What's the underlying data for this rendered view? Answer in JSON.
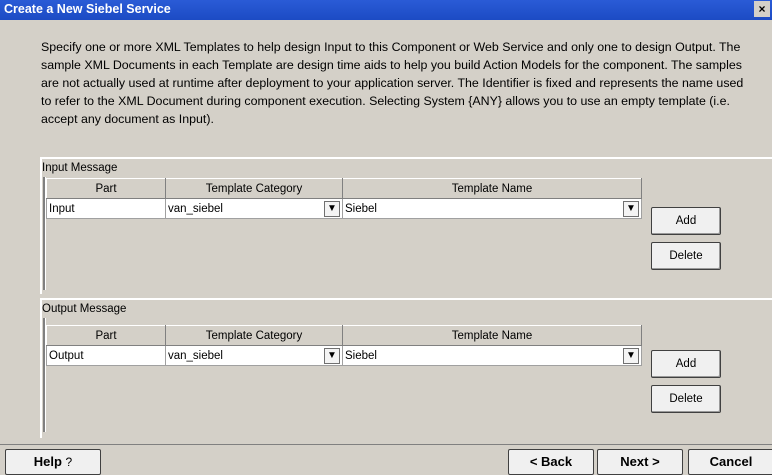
{
  "window": {
    "title": "Create a New Siebel Service",
    "close_label": "×"
  },
  "description": "Specify one or more XML Templates to help design Input to this Component or Web Service and only one to design Output. The sample XML Documents in each Template are design time aids to help you build Action Models for the component. The samples are not actually used at runtime after deployment to your application server. The Identifier is fixed and represents the name used to refer to the XML Document during component execution. Selecting System {ANY} allows you to use an empty template (i.e. accept any document as Input).",
  "input_group": {
    "label": "Input Message",
    "headers": [
      "Part",
      "Template Category",
      "Template Name"
    ],
    "row": {
      "part": "Input",
      "category": "van_siebel",
      "name": "Siebel"
    },
    "add": "Add",
    "delete": "Delete"
  },
  "output_group": {
    "label": "Output Message",
    "headers": [
      "Part",
      "Template Category",
      "Template Name"
    ],
    "row": {
      "part": "Output",
      "category": "van_siebel",
      "name": "Siebel"
    },
    "add": "Add",
    "delete": "Delete"
  },
  "footer": {
    "help": "Help",
    "back": "< Back",
    "next": "Next >",
    "cancel": "Cancel"
  },
  "icons": {
    "help": "help-circle-icon",
    "dropdown": "chevron-down-icon"
  }
}
